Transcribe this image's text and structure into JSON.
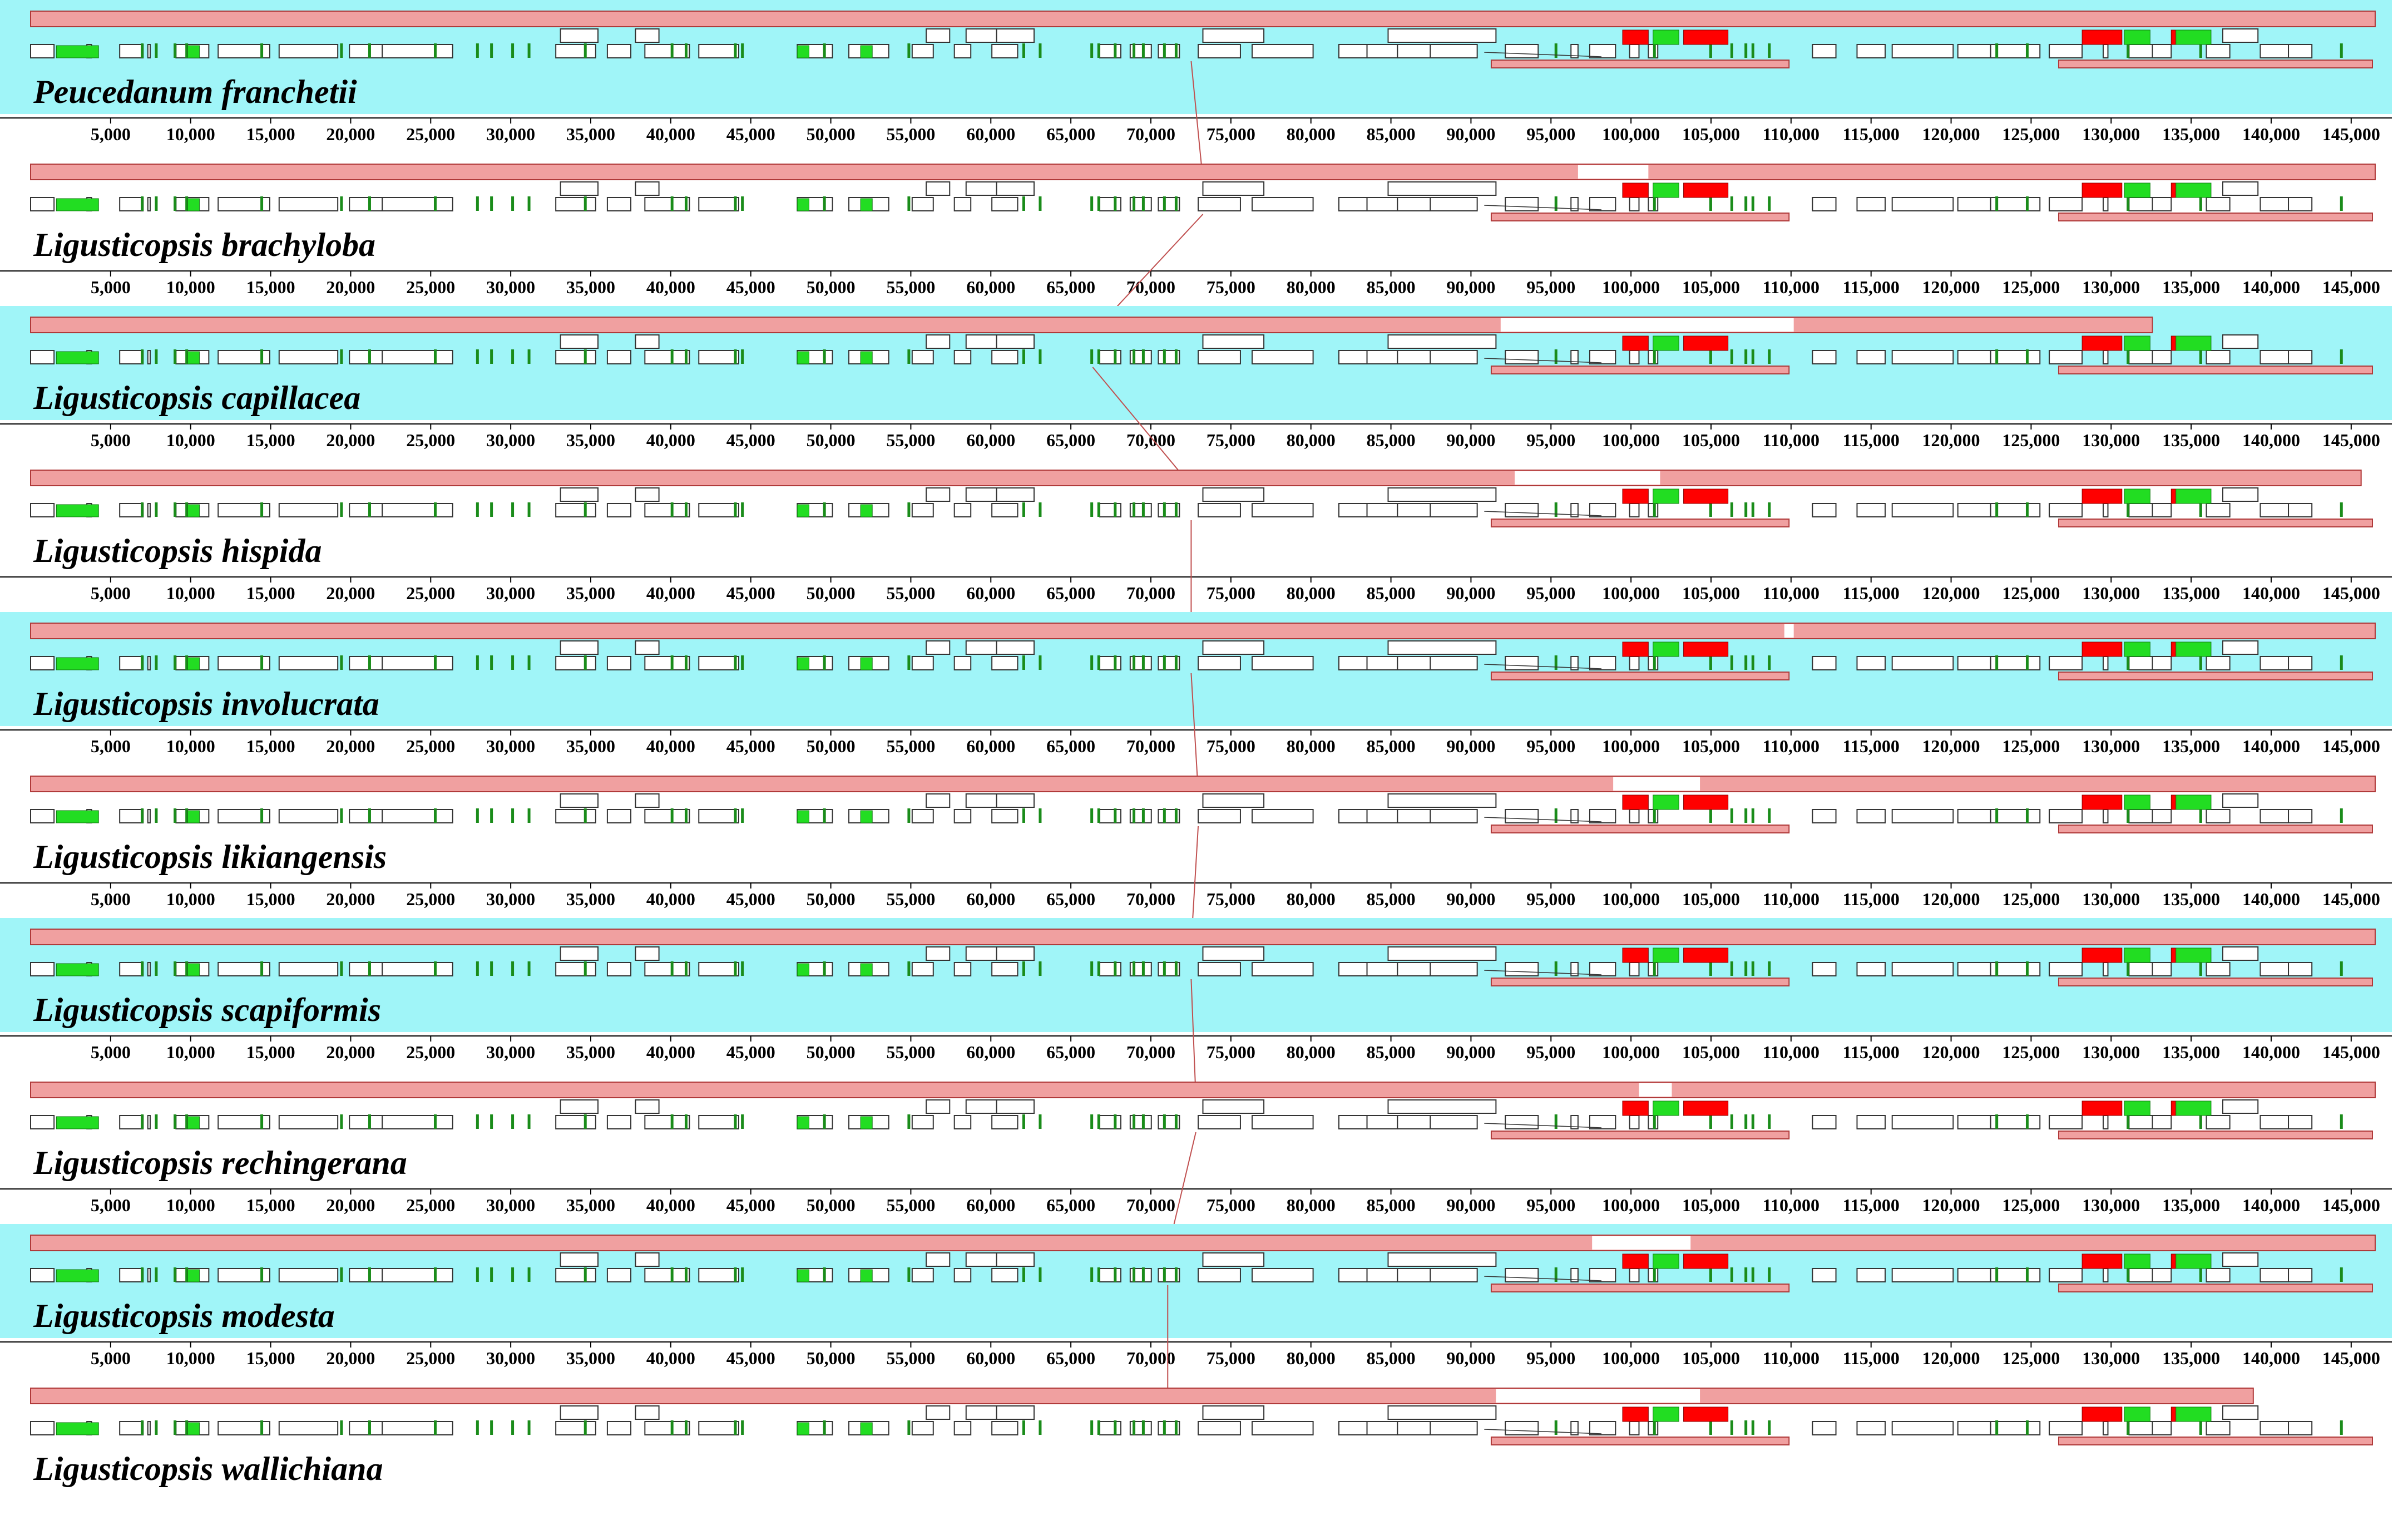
{
  "title": "",
  "colors": {
    "band": "#a0f5f8",
    "block": "#f0a0a0",
    "block_outline": "#b03a3a",
    "gene_box": "#ffffff",
    "gene_outline": "#333333",
    "trna": "#1a8c1a",
    "rrna": "#ff0000",
    "rrna_green": "#22dd22",
    "connector": "#c05050"
  },
  "axis": {
    "unit": "bp",
    "max": 145000,
    "tick_step": 5000,
    "tick_labels": [
      "5,000",
      "10,000",
      "15,000",
      "20,000",
      "25,000",
      "30,000",
      "35,000",
      "40,000",
      "45,000",
      "50,000",
      "55,000",
      "60,000",
      "65,000",
      "70,000",
      "75,000",
      "80,000",
      "85,000",
      "90,000",
      "95,000",
      "100,000",
      "105,000",
      "110,000",
      "115,000",
      "120,000",
      "125,000",
      "130,000",
      "135,000",
      "140,000",
      "145,000"
    ]
  },
  "genomes": [
    {
      "name": "Peucedanum franchetii",
      "band": true,
      "block_end_fraction": 1.0,
      "gap": [],
      "connector_x_fraction": 0.495
    },
    {
      "name": "Ligusticopsis brachyloba",
      "band": false,
      "block_end_fraction": 1.0,
      "gap": [
        0.66,
        0.69
      ],
      "connector_x_fraction": 0.5
    },
    {
      "name": "Ligusticopsis capillacea",
      "band": true,
      "block_end_fraction": 0.905,
      "gap": [
        0.627,
        0.752
      ],
      "connector_x_fraction": 0.453
    },
    {
      "name": "Ligusticopsis hispida",
      "band": false,
      "block_end_fraction": 0.994,
      "gap": [
        0.633,
        0.695
      ],
      "connector_x_fraction": 0.495
    },
    {
      "name": "Ligusticopsis involucrata",
      "band": true,
      "block_end_fraction": 1.0,
      "gap": [
        0.748,
        0.752
      ],
      "connector_x_fraction": 0.495
    },
    {
      "name": "Ligusticopsis likiangensis",
      "band": false,
      "block_end_fraction": 1.0,
      "gap": [
        0.675,
        0.712
      ],
      "connector_x_fraction": 0.498
    },
    {
      "name": "Ligusticopsis scapiformis",
      "band": true,
      "block_end_fraction": 1.0,
      "gap": [],
      "connector_x_fraction": 0.495
    },
    {
      "name": "Ligusticopsis rechingerana",
      "band": false,
      "block_end_fraction": 1.0,
      "gap": [
        0.686,
        0.7
      ],
      "connector_x_fraction": 0.497
    },
    {
      "name": "Ligusticopsis modesta",
      "band": true,
      "block_end_fraction": 1.0,
      "gap": [
        0.666,
        0.708
      ],
      "connector_x_fraction": 0.485
    },
    {
      "name": "Ligusticopsis wallichiana",
      "band": false,
      "block_end_fraction": 0.948,
      "gap": [
        0.625,
        0.712
      ],
      "connector_x_fraction": null
    }
  ],
  "gene_track": {
    "white_boxes": [
      [
        0.0,
        0.01
      ],
      [
        0.024,
        0.026
      ],
      [
        0.038,
        0.048
      ],
      [
        0.05,
        0.051
      ],
      [
        0.062,
        0.076
      ],
      [
        0.08,
        0.102
      ],
      [
        0.106,
        0.131
      ],
      [
        0.136,
        0.15
      ],
      [
        0.15,
        0.18
      ],
      [
        0.224,
        0.241
      ],
      [
        0.246,
        0.256
      ],
      [
        0.262,
        0.281
      ],
      [
        0.285,
        0.302
      ],
      [
        0.327,
        0.342
      ],
      [
        0.349,
        0.366
      ],
      [
        0.376,
        0.385
      ],
      [
        0.394,
        0.401
      ],
      [
        0.41,
        0.421
      ],
      [
        0.456,
        0.465
      ],
      [
        0.469,
        0.478
      ],
      [
        0.481,
        0.49
      ],
      [
        0.498,
        0.516
      ],
      [
        0.521,
        0.547
      ],
      [
        0.558,
        0.57
      ],
      [
        0.57,
        0.583
      ],
      [
        0.583,
        0.597
      ],
      [
        0.597,
        0.617
      ],
      [
        0.629,
        0.643
      ],
      [
        0.657,
        0.66
      ],
      [
        0.665,
        0.676
      ],
      [
        0.682,
        0.686
      ],
      [
        0.69,
        0.694
      ],
      [
        0.76,
        0.77
      ],
      [
        0.779,
        0.791
      ],
      [
        0.794,
        0.82
      ],
      [
        0.822,
        0.836
      ],
      [
        0.836,
        0.857
      ],
      [
        0.861,
        0.875
      ],
      [
        0.884,
        0.886
      ],
      [
        0.895,
        0.905
      ],
      [
        0.905,
        0.913
      ],
      [
        0.928,
        0.938
      ],
      [
        0.951,
        0.963
      ],
      [
        0.963,
        0.973
      ]
    ],
    "tall_boxes": [
      [
        0.226,
        0.242
      ],
      [
        0.258,
        0.268
      ],
      [
        0.382,
        0.392
      ],
      [
        0.399,
        0.413
      ],
      [
        0.412,
        0.428
      ],
      [
        0.5,
        0.526
      ],
      [
        0.579,
        0.625
      ],
      [
        0.935,
        0.95
      ]
    ],
    "trna_ticks": [
      0.047,
      0.053,
      0.061,
      0.066,
      0.098,
      0.132,
      0.144,
      0.172,
      0.19,
      0.196,
      0.205,
      0.212,
      0.236,
      0.273,
      0.279,
      0.3,
      0.303,
      0.338,
      0.374,
      0.423,
      0.43,
      0.452,
      0.455,
      0.462,
      0.47,
      0.474,
      0.483,
      0.488,
      0.65,
      0.692,
      0.716,
      0.725,
      0.731,
      0.734,
      0.741,
      0.838,
      0.851,
      0.894,
      0.925,
      0.985
    ],
    "green_boxes": [
      [
        0.011,
        0.029
      ],
      [
        0.067,
        0.072
      ],
      [
        0.327,
        0.332
      ],
      [
        0.354,
        0.359
      ]
    ],
    "rrna_red": [
      [
        0.679,
        0.69
      ],
      [
        0.705,
        0.724
      ],
      [
        0.875,
        0.892
      ],
      [
        0.913,
        0.923
      ]
    ],
    "rrna_green": [
      [
        0.692,
        0.703
      ],
      [
        0.893,
        0.904
      ],
      [
        0.915,
        0.93
      ]
    ],
    "ir_bar": [
      0.623,
      0.75
    ],
    "ir_bar2": [
      0.865,
      1.0
    ]
  }
}
